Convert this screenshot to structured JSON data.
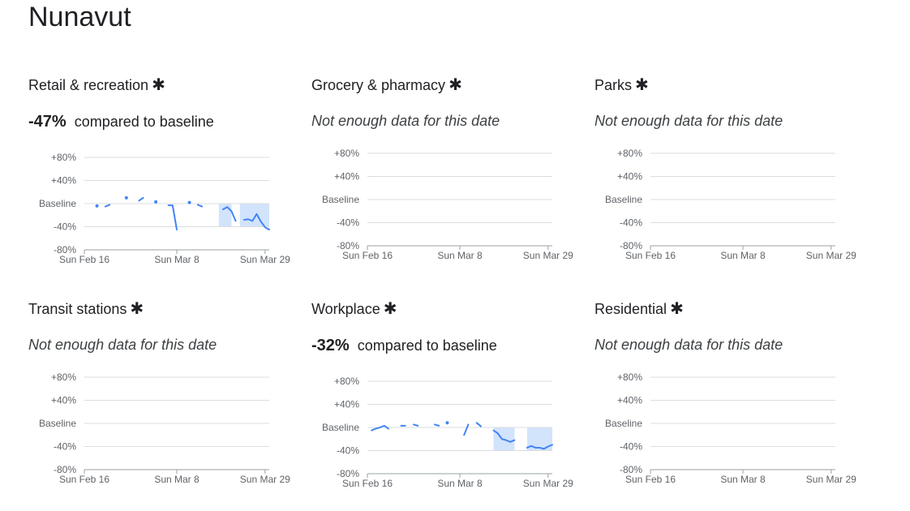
{
  "page_title": "Nunavut",
  "colors": {
    "line": "#4285f4",
    "shade": "#d2e3fc",
    "grid": "#dadce0",
    "axis": "#9aa0a6"
  },
  "chart_data": [
    {
      "type": "line",
      "title": "Retail & recreation",
      "marker": "✱",
      "summary_value": "-47%",
      "summary_caption": "compared to baseline",
      "no_data_text": "",
      "yticks": [
        "+80%",
        "+40%",
        "Baseline",
        "-40%",
        "-80%"
      ],
      "ylim": [
        -80,
        80
      ],
      "xlim": [
        0,
        44
      ],
      "xticks": [
        {
          "x": 0,
          "label": "Sun Feb 16"
        },
        {
          "x": 22,
          "label": "Sun Mar 8"
        },
        {
          "x": 43,
          "label": "Sun Mar 29"
        }
      ],
      "shaded_ranges": [
        [
          32,
          35
        ],
        [
          37,
          44
        ]
      ],
      "series": [
        {
          "points": [
            [
              3,
              -4
            ],
            [
              5,
              -5
            ],
            [
              6,
              -2
            ],
            [
              10,
              10
            ],
            [
              13,
              5
            ],
            [
              14,
              10
            ],
            [
              17,
              3
            ],
            [
              20,
              -3
            ],
            [
              21,
              -3
            ],
            [
              22,
              -45
            ],
            [
              25,
              2
            ],
            [
              27,
              -2
            ],
            [
              28,
              -5
            ],
            [
              33,
              -10
            ],
            [
              34,
              -6
            ],
            [
              35,
              -13
            ],
            [
              36,
              -30
            ],
            [
              38,
              -28
            ],
            [
              39,
              -27
            ],
            [
              40,
              -30
            ],
            [
              41,
              -18
            ],
            [
              42,
              -31
            ],
            [
              43,
              -41
            ],
            [
              44,
              -45
            ]
          ]
        }
      ]
    },
    {
      "type": "line",
      "title": "Grocery & pharmacy",
      "marker": "✱",
      "summary_value": "",
      "summary_caption": "",
      "no_data_text": "Not enough data for this date",
      "yticks": [
        "+80%",
        "+40%",
        "Baseline",
        "-40%",
        "-80%"
      ],
      "ylim": [
        -80,
        80
      ],
      "xlim": [
        0,
        44
      ],
      "xticks": [
        {
          "x": 0,
          "label": "Sun Feb 16"
        },
        {
          "x": 22,
          "label": "Sun Mar 8"
        },
        {
          "x": 43,
          "label": "Sun Mar 29"
        }
      ],
      "shaded_ranges": [],
      "series": []
    },
    {
      "type": "line",
      "title": "Parks",
      "marker": "✱",
      "summary_value": "",
      "summary_caption": "",
      "no_data_text": "Not enough data for this date",
      "yticks": [
        "+80%",
        "+40%",
        "Baseline",
        "-40%",
        "-80%"
      ],
      "ylim": [
        -80,
        80
      ],
      "xlim": [
        0,
        44
      ],
      "xticks": [
        {
          "x": 0,
          "label": "Sun Feb 16"
        },
        {
          "x": 22,
          "label": "Sun Mar 8"
        },
        {
          "x": 43,
          "label": "Sun Mar 29"
        }
      ],
      "shaded_ranges": [],
      "series": []
    },
    {
      "type": "line",
      "title": "Transit stations",
      "marker": "✱",
      "summary_value": "",
      "summary_caption": "",
      "no_data_text": "Not enough data for this date",
      "yticks": [
        "+80%",
        "+40%",
        "Baseline",
        "-40%",
        "-80%"
      ],
      "ylim": [
        -80,
        80
      ],
      "xlim": [
        0,
        44
      ],
      "xticks": [
        {
          "x": 0,
          "label": "Sun Feb 16"
        },
        {
          "x": 22,
          "label": "Sun Mar 8"
        },
        {
          "x": 43,
          "label": "Sun Mar 29"
        }
      ],
      "shaded_ranges": [],
      "series": []
    },
    {
      "type": "line",
      "title": "Workplace",
      "marker": "✱",
      "summary_value": "-32%",
      "summary_caption": "compared to baseline",
      "no_data_text": "",
      "yticks": [
        "+80%",
        "+40%",
        "Baseline",
        "-40%",
        "-80%"
      ],
      "ylim": [
        -80,
        80
      ],
      "xlim": [
        0,
        44
      ],
      "xticks": [
        {
          "x": 0,
          "label": "Sun Feb 16"
        },
        {
          "x": 22,
          "label": "Sun Mar 8"
        },
        {
          "x": 43,
          "label": "Sun Mar 29"
        }
      ],
      "shaded_ranges": [
        [
          30,
          35
        ],
        [
          38,
          44
        ]
      ],
      "series": [
        {
          "points": [
            [
              1,
              -5
            ],
            [
              2,
              -2
            ],
            [
              3,
              0
            ],
            [
              4,
              3
            ],
            [
              5,
              -2
            ],
            [
              8,
              3
            ],
            [
              9,
              3
            ],
            [
              11,
              5
            ],
            [
              12,
              3
            ],
            [
              16,
              5
            ],
            [
              17,
              3
            ],
            [
              19,
              8
            ],
            [
              23,
              -13
            ],
            [
              24,
              5
            ],
            [
              26,
              8
            ],
            [
              27,
              2
            ],
            [
              30,
              -5
            ],
            [
              31,
              -10
            ],
            [
              32,
              -20
            ],
            [
              33,
              -22
            ],
            [
              34,
              -25
            ],
            [
              35,
              -22
            ],
            [
              38,
              -35
            ],
            [
              39,
              -32
            ],
            [
              40,
              -35
            ],
            [
              41,
              -35
            ],
            [
              42,
              -37
            ],
            [
              43,
              -33
            ],
            [
              44,
              -30
            ]
          ]
        }
      ]
    },
    {
      "type": "line",
      "title": "Residential",
      "marker": "✱",
      "summary_value": "",
      "summary_caption": "",
      "no_data_text": "Not enough data for this date",
      "yticks": [
        "+80%",
        "+40%",
        "Baseline",
        "-40%",
        "-80%"
      ],
      "ylim": [
        -80,
        80
      ],
      "xlim": [
        0,
        44
      ],
      "xticks": [
        {
          "x": 0,
          "label": "Sun Feb 16"
        },
        {
          "x": 22,
          "label": "Sun Mar 8"
        },
        {
          "x": 43,
          "label": "Sun Mar 29"
        }
      ],
      "shaded_ranges": [],
      "series": []
    }
  ]
}
